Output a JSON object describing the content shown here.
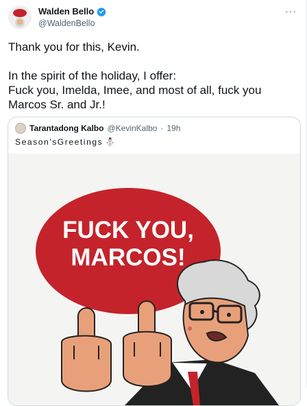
{
  "tweet": {
    "author_name": "Walden Bello",
    "author_handle": "@WaldenBello",
    "more_label": "···",
    "text_line1": "Thank you for this, Kevin.",
    "text_line2": "In the spirit of the holiday, I offer:",
    "text_line3": "Fuck you, Imelda, Imee, and most of all, fuck you",
    "text_line4": "Marcos Sr. and Jr.!"
  },
  "quote": {
    "author_name": "Tarantadong Kalbo",
    "author_handle": "@KevinKalbo",
    "separator": "·",
    "time": "19h",
    "text": "Season'sGreetings",
    "emoji": "⛄",
    "image": {
      "bubble_line1": "FUCK YOU,",
      "bubble_line2": "MARCOS!"
    }
  },
  "colors": {
    "verified": "#1d9bf0",
    "bubble": "#c4232b",
    "border": "#cfd9de",
    "secondary_text": "#536471"
  }
}
